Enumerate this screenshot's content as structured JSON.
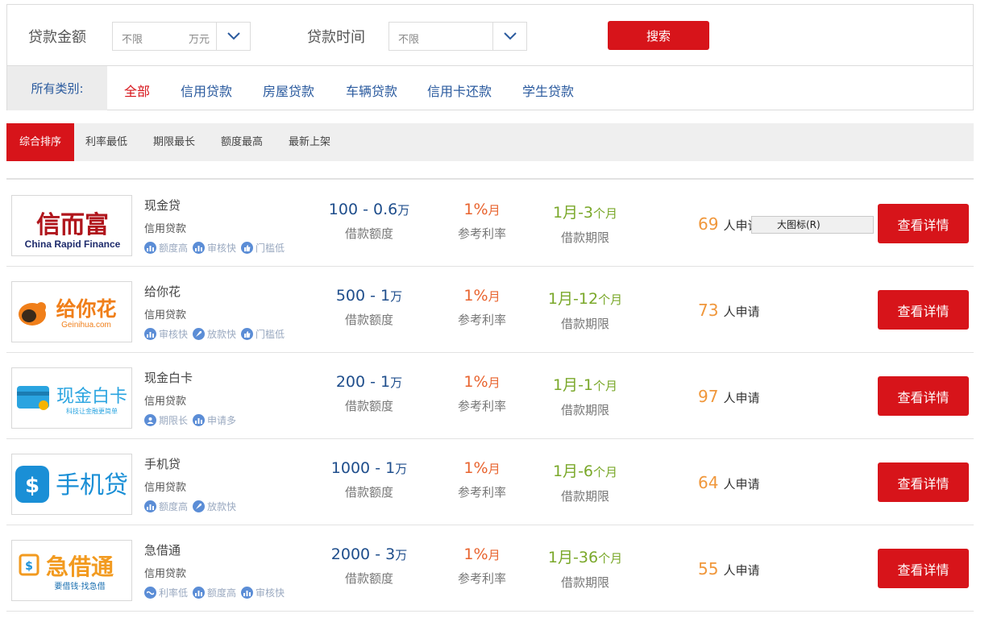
{
  "search": {
    "amount_label": "贷款金额",
    "amount_value": "不限",
    "amount_unit": "万元",
    "time_label": "贷款时间",
    "time_value": "不限",
    "button": "搜索"
  },
  "categories": {
    "label": "所有类别:",
    "items": [
      "全部",
      "信用贷款",
      "房屋贷款",
      "车辆贷款",
      "信用卡还款",
      "学生贷款"
    ],
    "active": "全部"
  },
  "sort": {
    "items": [
      "综合排序",
      "利率最低",
      "期限最长",
      "额度最高",
      "最新上架"
    ],
    "active": "综合排序"
  },
  "labels": {
    "amount": "借款额度",
    "rate": "参考利率",
    "term": "借款期限",
    "applicants_suffix": "人申请",
    "detail_button": "查看详情"
  },
  "products": [
    {
      "name": "现金贷",
      "type": "信用贷款",
      "logo": {
        "main": "信而富",
        "sub": "China Rapid Finance",
        "color": "#b0151c"
      },
      "tags": [
        "额度高",
        "审核快",
        "门槛低"
      ],
      "amount_min": "100",
      "amount_max": "0.6",
      "amount_unit": "万",
      "rate": "1%",
      "rate_unit": "月",
      "term_min": "1月",
      "term_max": "3",
      "term_unit": "个月",
      "applicants": "69"
    },
    {
      "name": "给你花",
      "type": "信用贷款",
      "logo": {
        "main": "给你花",
        "sub": "Geinihua.com",
        "color": "#f07f1a"
      },
      "tags": [
        "审核快",
        "放款快",
        "门槛低"
      ],
      "amount_min": "500",
      "amount_max": "1",
      "amount_unit": "万",
      "rate": "1%",
      "rate_unit": "月",
      "term_min": "1月",
      "term_max": "12",
      "term_unit": "个月",
      "applicants": "73"
    },
    {
      "name": "现金白卡",
      "type": "信用贷款",
      "logo": {
        "main": "现金白卡",
        "sub": "科技让金融更简单",
        "color": "#2aa4e0"
      },
      "tags": [
        "期限长",
        "申请多"
      ],
      "amount_min": "200",
      "amount_max": "1",
      "amount_unit": "万",
      "rate": "1%",
      "rate_unit": "月",
      "term_min": "1月",
      "term_max": "1",
      "term_unit": "个月",
      "applicants": "97"
    },
    {
      "name": "手机贷",
      "type": "信用贷款",
      "logo": {
        "main": "手机贷",
        "sub": "",
        "color": "#1a8fd6"
      },
      "tags": [
        "额度高",
        "放款快"
      ],
      "amount_min": "1000",
      "amount_max": "1",
      "amount_unit": "万",
      "rate": "1%",
      "rate_unit": "月",
      "term_min": "1月",
      "term_max": "6",
      "term_unit": "个月",
      "applicants": "64"
    },
    {
      "name": "急借通",
      "type": "信用贷款",
      "logo": {
        "main": "急借通",
        "sub": "要借钱·找急借",
        "color": "#f29a1f"
      },
      "tags": [
        "利率低",
        "额度高",
        "审核快"
      ],
      "amount_min": "2000",
      "amount_max": "3",
      "amount_unit": "万",
      "rate": "1%",
      "rate_unit": "月",
      "term_min": "1月",
      "term_max": "36",
      "term_unit": "个月",
      "applicants": "55"
    }
  ],
  "context_menu": {
    "item": "大图标(R)"
  },
  "colors": {
    "accent": "#d7141a",
    "link": "#2a5a9e",
    "amount": "#1f4e8c",
    "rate": "#e8632e",
    "term": "#7aa82a",
    "applicants": "#f0973b"
  }
}
